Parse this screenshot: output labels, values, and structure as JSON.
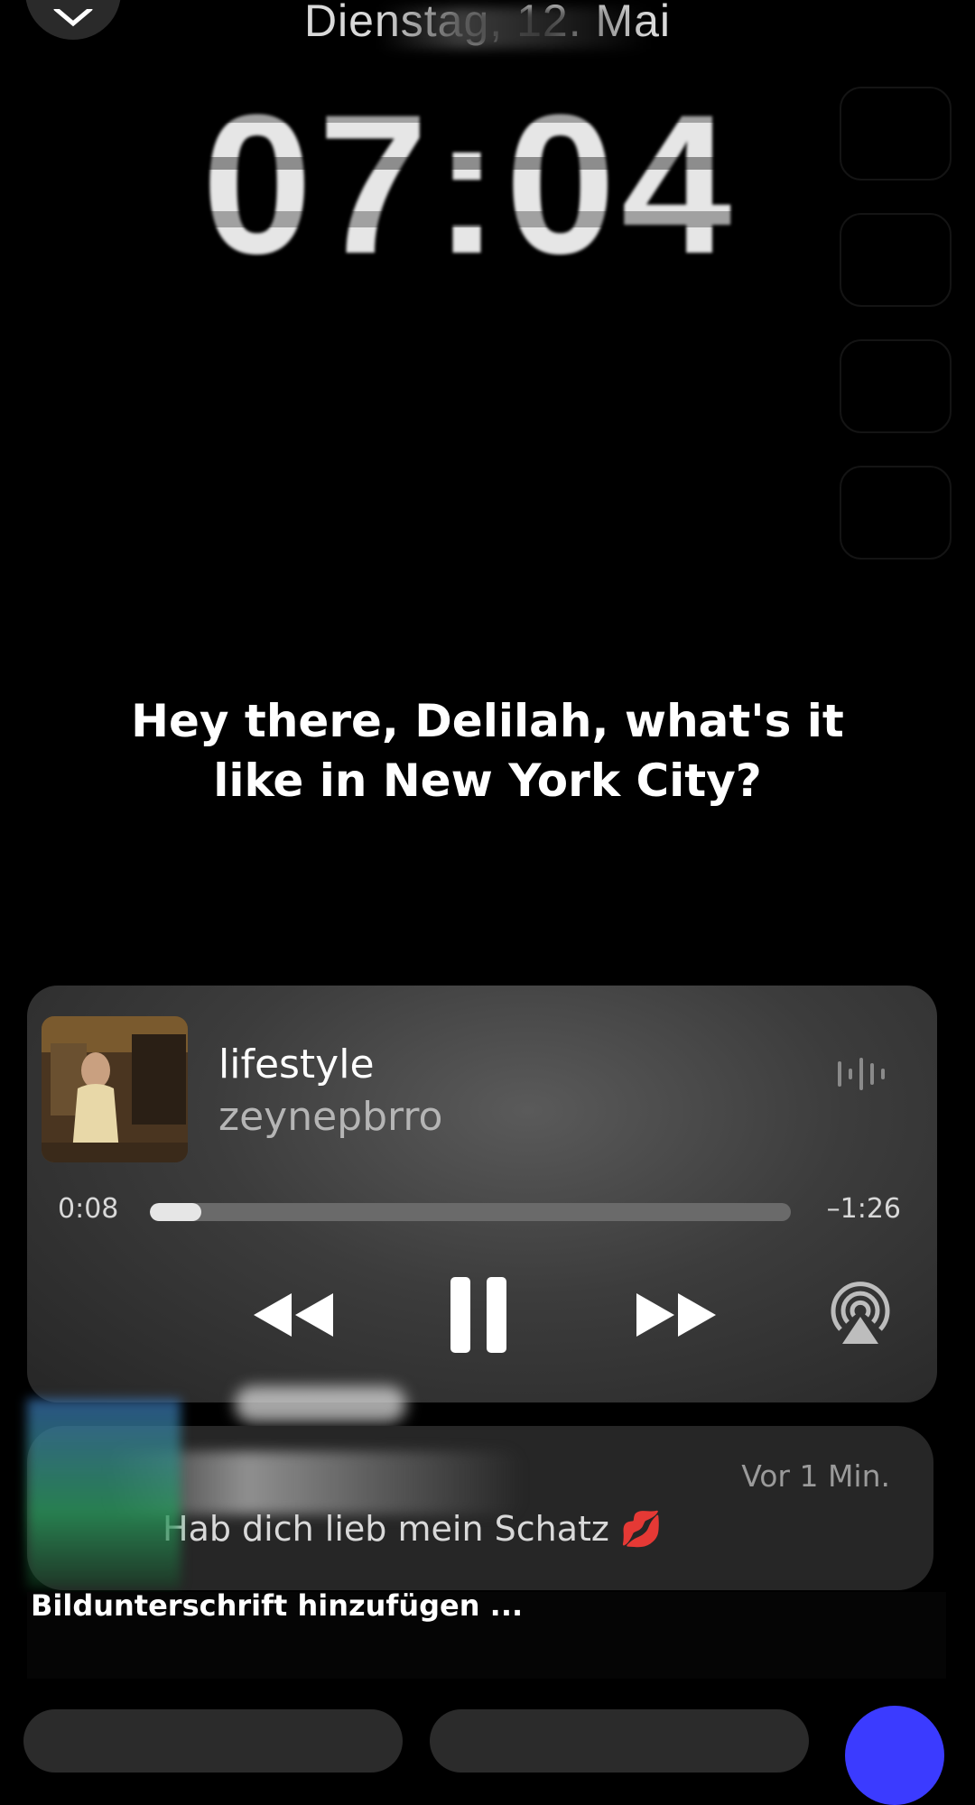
{
  "lock_screen": {
    "date": "Dienstag, 12. Mai",
    "time": "07:04"
  },
  "lyrics": {
    "text": "Hey there, Delilah, what's it like in New York City?"
  },
  "player": {
    "title": "lifestyle",
    "artist": "zeynepbrro",
    "elapsed": "0:08",
    "remaining": "–1:26",
    "progress_fraction": 0.08,
    "icons": [
      "waveform-icon",
      "rewind-icon",
      "pause-icon",
      "fast-forward-icon",
      "airplay-icon"
    ]
  },
  "notification": {
    "time": "Vor 1 Min.",
    "message": "Hab dich lieb mein Schatz 💋"
  },
  "caption": {
    "placeholder": "Bildunterschrift hinzufügen ..."
  },
  "colors": {
    "accent": "#3b3bff",
    "player_bg": "#3c3c3c",
    "notification_bg": "#262626"
  }
}
